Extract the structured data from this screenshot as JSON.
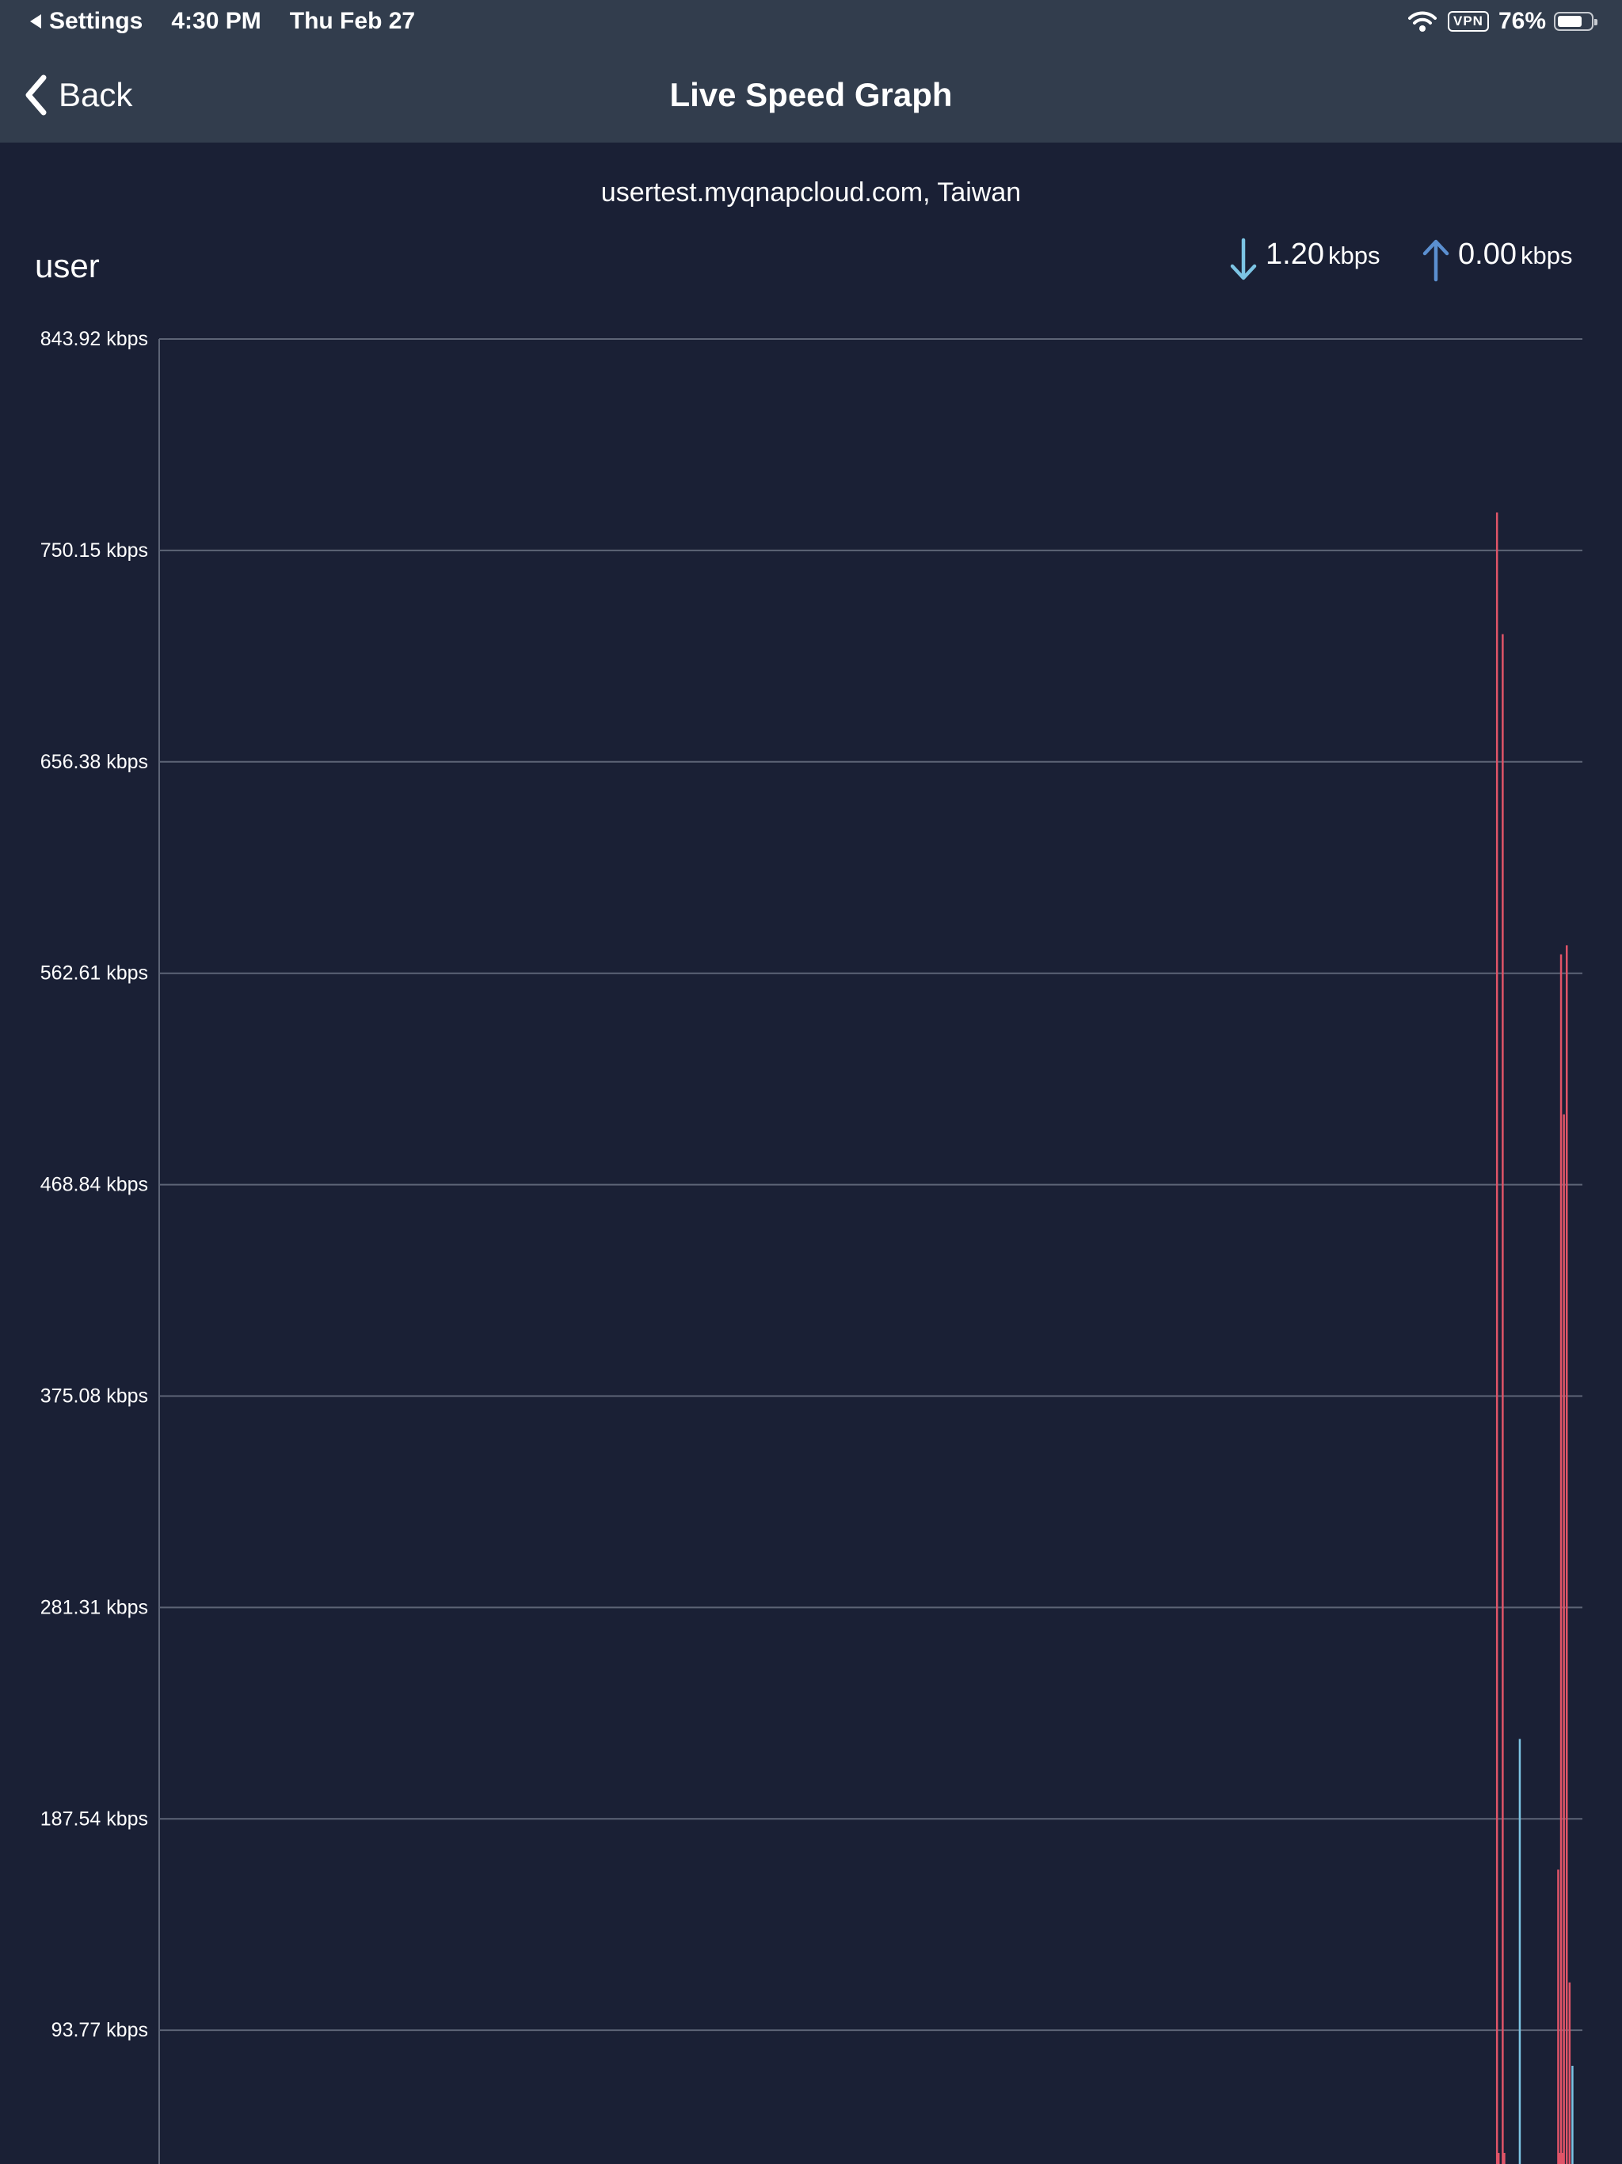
{
  "status_bar": {
    "back_app": "Settings",
    "time": "4:30 PM",
    "date": "Thu Feb 27",
    "vpn": "VPN",
    "battery": "76%",
    "battery_level": 0.76
  },
  "nav": {
    "back_label": "Back",
    "title": "Live Speed Graph"
  },
  "server": "usertest.myqnapcloud.com, Taiwan",
  "user": "user",
  "download": {
    "value": "1.20",
    "unit": "kbps"
  },
  "upload": {
    "value": "0.00",
    "unit": "kbps"
  },
  "colors": {
    "background": "#1a2035",
    "header": "#323d4d",
    "download": "#e05468",
    "upload": "#7cc4e4",
    "upload_arrow": "#5b8fd0",
    "gridline": "#5d6476"
  },
  "chart_data": {
    "type": "line",
    "ylim": [
      0,
      843.92
    ],
    "y_ticks": [
      "93.77 kbps",
      "187.54 kbps",
      "281.31 kbps",
      "375.08 kbps",
      "468.84 kbps",
      "562.61 kbps",
      "656.38 kbps",
      "750.15 kbps",
      "843.92 kbps"
    ],
    "y_tick_values": [
      93.77,
      187.54,
      281.31,
      375.08,
      468.84,
      562.61,
      656.38,
      750.15,
      843.92
    ],
    "grid": true,
    "x_range": [
      0,
      100
    ],
    "series": [
      {
        "values": [
          {
            "x": 94.0,
            "y": 767
          },
          {
            "x": 94.4,
            "y": 713
          },
          {
            "x": 98.3,
            "y": 165
          },
          {
            "x": 98.5,
            "y": 571
          },
          {
            "x": 98.7,
            "y": 500
          },
          {
            "x": 98.9,
            "y": 575
          },
          {
            "x": 99.1,
            "y": 115
          }
        ]
      },
      {
        "values": [
          {
            "x": 95.6,
            "y": 223
          },
          {
            "x": 99.3,
            "y": 78
          }
        ]
      }
    ]
  }
}
